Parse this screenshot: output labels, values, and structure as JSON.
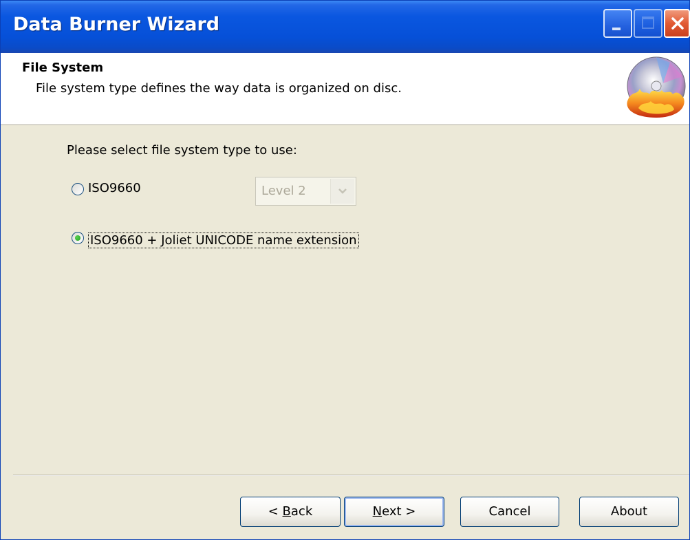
{
  "window": {
    "title": "Data Burner Wizard"
  },
  "header": {
    "title": "File System",
    "subtitle": "File system type defines the way data is organized on disc.",
    "logo_icon": "burning-disc-icon"
  },
  "content": {
    "prompt": "Please select file system type to use:",
    "options": [
      {
        "label": "ISO9660",
        "selected": false
      },
      {
        "label": "ISO9660 + Joliet UNICODE name extension",
        "selected": true
      }
    ],
    "level_select": {
      "value": "Level 2",
      "enabled": false
    }
  },
  "buttons": {
    "back": {
      "prefix": "< ",
      "accel": "B",
      "rest": "ack"
    },
    "next": {
      "accel": "N",
      "rest": "ext >"
    },
    "cancel": "Cancel",
    "about": "About"
  },
  "colors": {
    "titlebar": "#0a57e0",
    "panel": "#ece9d8",
    "close_button": "#e25a33"
  }
}
